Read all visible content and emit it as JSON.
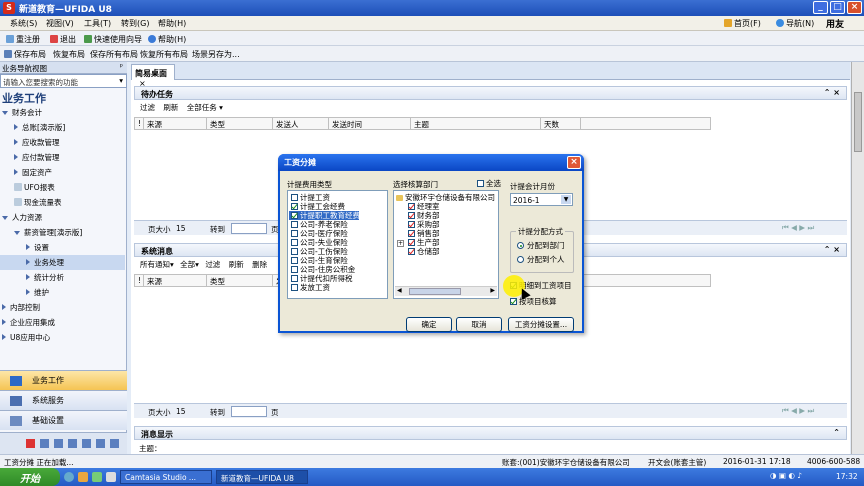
{
  "window": {
    "title": "新道教育—UFIDA U8",
    "logo": "S"
  },
  "menubar": {
    "items": [
      "系统(S)",
      "视图(V)",
      "工具(T)",
      "转到(G)",
      "帮助(H)"
    ],
    "right": [
      "首页(F)",
      "导航(N)",
      "用友"
    ]
  },
  "toolbar1": {
    "items": [
      "重注册",
      "退出",
      "快速使用向导",
      "帮助(H)"
    ]
  },
  "toolbar2": {
    "items": [
      "保存布局",
      "恢复布局",
      "保存所有布局",
      "恢复所有布局",
      "场景另存为..."
    ]
  },
  "sidebar": {
    "header": "业务导航视图",
    "search_placeholder": "请输入您要搜索的功能",
    "title": "业务工作",
    "tree": [
      {
        "label": "财务会计",
        "level": 0,
        "expanded": true
      },
      {
        "label": "总账[演示版]",
        "level": 1
      },
      {
        "label": "应收款管理",
        "level": 1
      },
      {
        "label": "应付款管理",
        "level": 1
      },
      {
        "label": "固定资产",
        "level": 1
      },
      {
        "label": "UFO报表",
        "level": 1
      },
      {
        "label": "现金流量表",
        "level": 1
      },
      {
        "label": "人力资源",
        "level": 0,
        "expanded": true
      },
      {
        "label": "薪资管理[演示版]",
        "level": 1,
        "expanded": true
      },
      {
        "label": "设置",
        "level": 2
      },
      {
        "label": "业务处理",
        "level": 2,
        "selected": true
      },
      {
        "label": "统计分析",
        "level": 2
      },
      {
        "label": "维护",
        "level": 2
      },
      {
        "label": "内部控制",
        "level": 0
      },
      {
        "label": "企业应用集成",
        "level": 0
      },
      {
        "label": "U8应用中心",
        "level": 0
      }
    ],
    "nav_buttons": [
      "业务工作",
      "系统服务",
      "基础设置"
    ]
  },
  "main": {
    "tab": "简易桌面",
    "todo": {
      "title": "待办任务",
      "toolbar": [
        "过滤",
        "刷新",
        "全部任务"
      ],
      "columns": [
        "!",
        "来源",
        "类型",
        "发送人",
        "发送时间",
        "主题",
        "天数"
      ]
    },
    "pager1": {
      "label_size": "页大小",
      "size": "15",
      "label_goto": "转到",
      "page_suffix": "页"
    },
    "msg": {
      "title": "系统消息",
      "toolbar": [
        "所有通知",
        "全部",
        "过滤",
        "刷新",
        "删除"
      ],
      "columns": [
        "!",
        "来源",
        "类型",
        "发"
      ]
    },
    "pager2": {
      "label_size": "页大小",
      "size": "15",
      "label_goto": "转到",
      "page_suffix": "页"
    },
    "msgshow": {
      "title": "消息显示",
      "subject_label": "主题："
    }
  },
  "dialog": {
    "title": "工资分摊",
    "cost_type_label": "计提费用类型",
    "cost_types": [
      {
        "label": "计提工资",
        "checked": false
      },
      {
        "label": "计提工会经费",
        "checked": true
      },
      {
        "label": "计提职工教育经费",
        "checked": true,
        "selected": true
      },
      {
        "label": "公司-养老保险",
        "checked": false
      },
      {
        "label": "公司-医疗保险",
        "checked": false
      },
      {
        "label": "公司-失业保险",
        "checked": false
      },
      {
        "label": "公司-工伤保险",
        "checked": false
      },
      {
        "label": "公司-生育保险",
        "checked": false
      },
      {
        "label": "公司-住房公积金",
        "checked": false
      },
      {
        "label": "计提代扣所得税",
        "checked": false
      },
      {
        "label": "发放工资",
        "checked": false
      }
    ],
    "dept_label": "选择核算部门",
    "select_all": "全选",
    "company": "安徽环宇仓储设备有限公司",
    "departments": [
      "经理室",
      "财务部",
      "采购部",
      "销售部",
      "生产部",
      "仓储部"
    ],
    "month_label": "计提会计月份",
    "month": "2016-1",
    "alloc_label": "计提分配方式",
    "alloc_options": [
      {
        "label": "分配到部门",
        "checked": true
      },
      {
        "label": "分配到个人",
        "checked": false
      }
    ],
    "detail_check": "明细到工资项目",
    "project_check": "按项目核算",
    "buttons": [
      "确定",
      "取消",
      "工资分摊设置..."
    ]
  },
  "statusbar": {
    "left": "工资分摊 正在加载...",
    "account": "账套:(001)安徽环宇仓储设备有限公司",
    "user": "开文会(账套主管)",
    "date": "2016-01-31 17:18",
    "phone": "4006-600-588"
  },
  "taskbar": {
    "start": "开始",
    "tasks": [
      "Camtasia Studio ...",
      "新道教育—UFIDA U8"
    ],
    "time": "17:32"
  }
}
